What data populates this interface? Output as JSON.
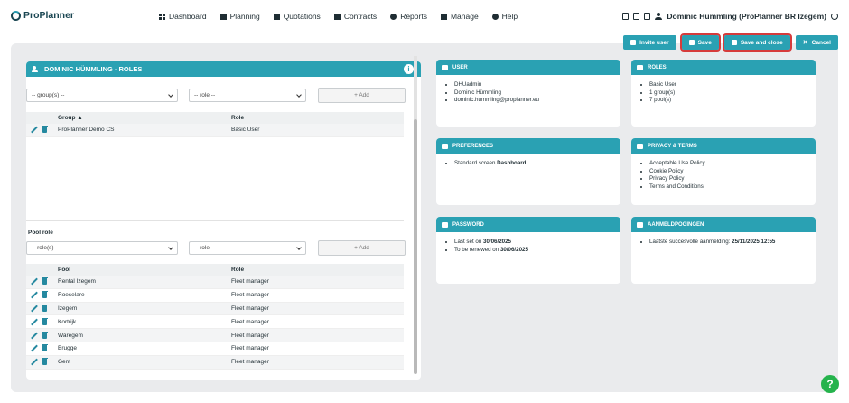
{
  "app": {
    "name": "ProPlanner"
  },
  "nav": {
    "items": [
      {
        "label": "Dashboard",
        "icon": "grid-icon"
      },
      {
        "label": "Planning",
        "icon": "calendar-icon"
      },
      {
        "label": "Quotations",
        "icon": "document-icon"
      },
      {
        "label": "Contracts",
        "icon": "contract-icon"
      },
      {
        "label": "Reports",
        "icon": "chart-pie-icon"
      },
      {
        "label": "Manage",
        "icon": "manage-icon"
      },
      {
        "label": "Help",
        "icon": "help-icon"
      }
    ]
  },
  "user": {
    "display": "Dominic Hümmling (ProPlanner BR Izegem)"
  },
  "actions": {
    "invite": "Invite user",
    "save": "Save",
    "save_close": "Save and close",
    "cancel": "Cancel"
  },
  "roles_panel": {
    "title": "DOMINIC HÜMMLING - ROLES",
    "group_select": "-- group(s) --",
    "role_select": "-- role --",
    "add_label": "+ Add",
    "group_table": {
      "headers": {
        "group": "Group",
        "role": "Role"
      },
      "rows": [
        {
          "group": "ProPlanner Demo CS",
          "role": "Basic User"
        }
      ]
    },
    "pool_section_label": "Pool role",
    "pool_select": "-- role(s) --",
    "pool_role_select": "-- role --",
    "pool_add_label": "+ Add",
    "pool_table": {
      "headers": {
        "pool": "Pool",
        "role": "Role"
      },
      "rows": [
        {
          "pool": "Rental Izegem",
          "role": "Fleet manager"
        },
        {
          "pool": "Roeselare",
          "role": "Fleet manager"
        },
        {
          "pool": "Izegem",
          "role": "Fleet manager"
        },
        {
          "pool": "Kortrijk",
          "role": "Fleet manager"
        },
        {
          "pool": "Waregem",
          "role": "Fleet manager"
        },
        {
          "pool": "Brugge",
          "role": "Fleet manager"
        },
        {
          "pool": "Gent",
          "role": "Fleet manager"
        }
      ]
    }
  },
  "cards": {
    "user": {
      "title": "USER",
      "items": [
        "DHUadmin",
        "Dominic Hümmling",
        "dominic.hummling@proplanner.eu"
      ]
    },
    "roles": {
      "title": "ROLES",
      "items": [
        "Basic User",
        "1 group(s)",
        "7 pool(s)"
      ]
    },
    "preferences": {
      "title": "PREFERENCES",
      "prefix": "Standard screen",
      "value": "Dashboard"
    },
    "privacy": {
      "title": "PRIVACY & TERMS",
      "items": [
        "Acceptable Use Policy",
        "Cookie Policy",
        "Privacy Policy",
        "Terms and Conditions"
      ]
    },
    "password": {
      "title": "PASSWORD",
      "items": [
        {
          "prefix": "Last set on",
          "value": "30/06/2025"
        },
        {
          "prefix": "To be renewed on",
          "value": "30/06/2025"
        }
      ]
    },
    "logins": {
      "title": "AANMELDPOGINGEN",
      "prefix": "Laatste succesvolle aanmelding:",
      "value": "25/11/2025 12:55"
    }
  },
  "help_bubble": "?",
  "colors": {
    "accent": "#2aa1b3",
    "highlight": "#d63b3b",
    "help": "#25b34c"
  }
}
